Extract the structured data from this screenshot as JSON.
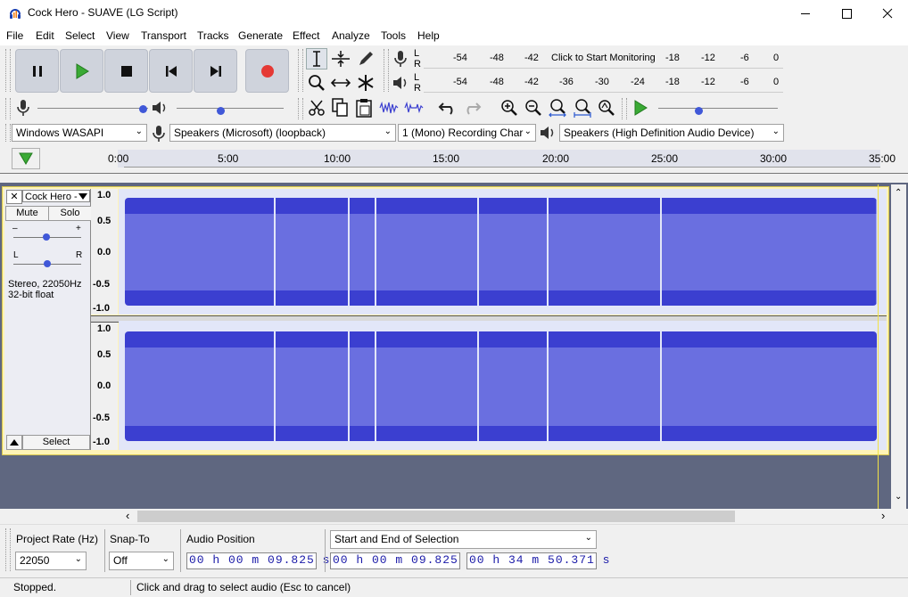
{
  "window": {
    "title": "Cock Hero - SUAVE (LG Script)"
  },
  "menu": [
    "File",
    "Edit",
    "Select",
    "View",
    "Transport",
    "Tracks",
    "Generate",
    "Effect",
    "Analyze",
    "Tools",
    "Help"
  ],
  "meters": {
    "record_scale_left": [
      "-54",
      "-48",
      "-42"
    ],
    "record_prompt": "Click to Start Monitoring",
    "record_scale_right": [
      "-18",
      "-12",
      "-6",
      "0"
    ],
    "playback_scale": [
      "-54",
      "-48",
      "-42",
      "-36",
      "-30",
      "-24",
      "-18",
      "-12",
      "-6",
      "0"
    ],
    "lr_top": "L",
    "lr_bottom": "R"
  },
  "device": {
    "host": "Windows WASAPI",
    "recording_device": "Speakers (Microsoft) (loopback)",
    "channels": "1 (Mono) Recording Char",
    "playback_device": "Speakers (High Definition Audio Device)"
  },
  "ruler": {
    "ticks": [
      "0:00",
      "5:00",
      "10:00",
      "15:00",
      "20:00",
      "25:00",
      "30:00",
      "35:00"
    ]
  },
  "track": {
    "name": "Cock Hero -",
    "mute": "Mute",
    "solo": "Solo",
    "gain_minus": "–",
    "gain_plus": "+",
    "pan_left": "L",
    "pan_right": "R",
    "info_line1": "Stereo, 22050Hz",
    "info_line2": "32-bit float",
    "select_label": "Select",
    "close_glyph": "✕",
    "vscale": [
      "1.0",
      "0.5",
      "0.0",
      "-0.5",
      "-1.0"
    ]
  },
  "selection_toolbar": {
    "project_rate_label": "Project Rate (Hz)",
    "project_rate_value": "22050",
    "snap_to_label": "Snap-To",
    "snap_to_value": "Off",
    "audio_position_label": "Audio Position",
    "audio_position_value": "00 h 00 m 09.825 s",
    "selection_mode": "Start and End of Selection",
    "selection_start": "00 h 00 m 09.825 s",
    "selection_end": "00 h 34 m 50.371 s"
  },
  "status": {
    "state": "Stopped.",
    "hint": "Click and drag to select audio (Esc to cancel)"
  },
  "colors": {
    "waveform": "#3b3fd0",
    "waveform_rms": "#6a6fe0",
    "track_selected_border": "#fff4b6",
    "record_button": "#e53935",
    "play_button": "#3aaa35"
  }
}
